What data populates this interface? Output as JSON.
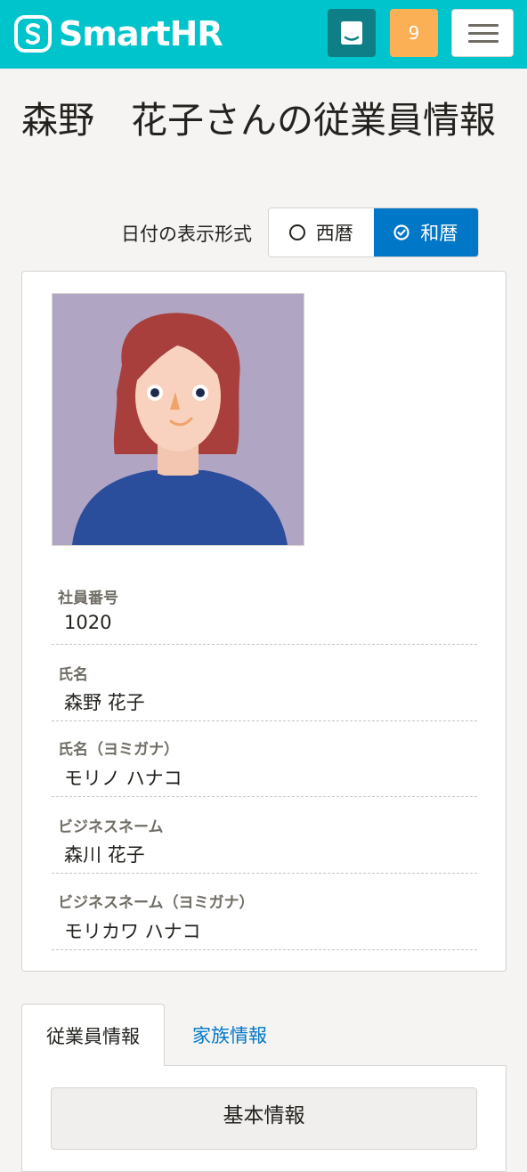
{
  "header": {
    "logo_text": "SmartHR",
    "help_icon": "help-book-icon",
    "notification_count": "9",
    "menu_icon": "hamburger-menu-icon",
    "brand_color": "#00c4cc"
  },
  "page": {
    "title": "森野　花子さんの従業員情報"
  },
  "date_format": {
    "label": "日付の表示形式",
    "options": [
      {
        "label": "西暦",
        "selected": false
      },
      {
        "label": "和暦",
        "selected": true
      }
    ],
    "accent_color": "#0077c7"
  },
  "profile": {
    "avatar_icon": "employee-photo",
    "fields": [
      {
        "label": "社員番号",
        "value": "1020"
      },
      {
        "label": "氏名",
        "value": "森野 花子"
      },
      {
        "label": "氏名（ヨミガナ）",
        "value": "モリノ ハナコ"
      },
      {
        "label": "ビジネスネーム",
        "value": "森川 花子"
      },
      {
        "label": "ビジネスネーム（ヨミガナ）",
        "value": "モリカワ ハナコ"
      }
    ]
  },
  "tabs": [
    {
      "label": "従業員情報",
      "active": true
    },
    {
      "label": "家族情報",
      "active": false
    }
  ],
  "section": {
    "title": "基本情報"
  }
}
